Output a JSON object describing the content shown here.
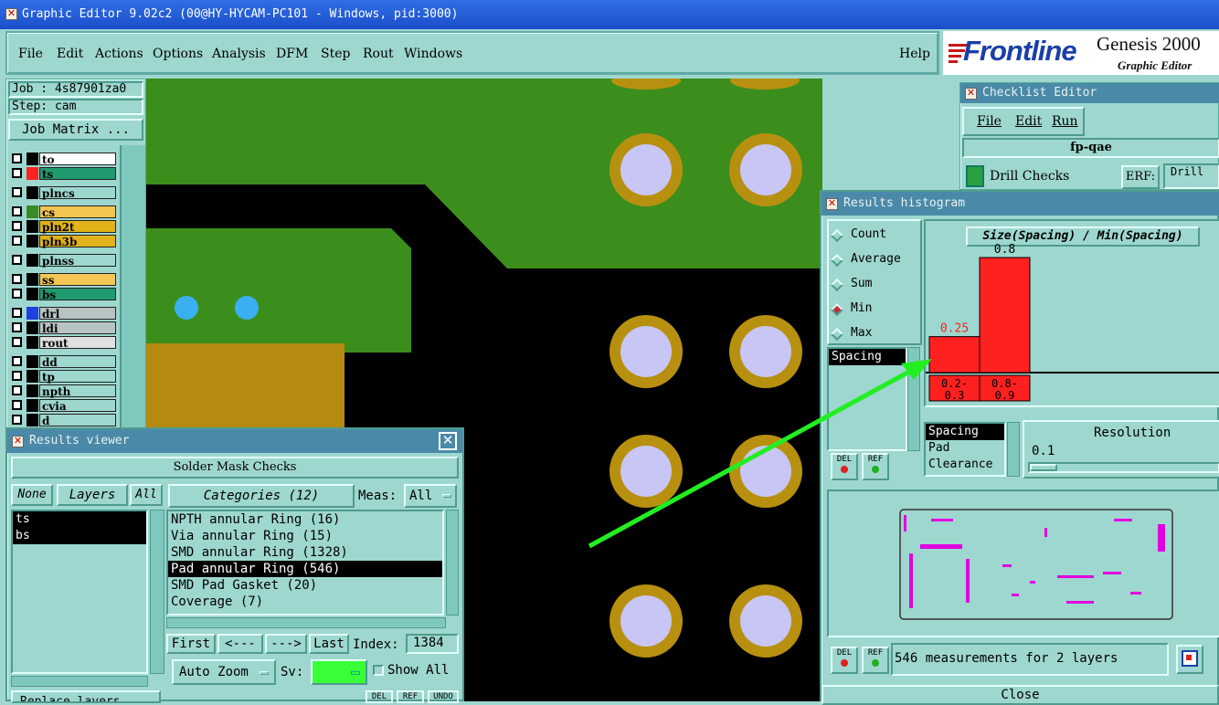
{
  "window": {
    "title": "Graphic Editor 9.02c2 (00@HY-HYCAM-PC101 - Windows, pid:3000)"
  },
  "menu": {
    "items": [
      "File",
      "Edit",
      "Actions",
      "Options",
      "Analysis",
      "DFM",
      "Step",
      "Rout",
      "Windows"
    ],
    "help": "Help"
  },
  "logo": {
    "brand": "Frontline",
    "product": "Genesis 2000",
    "subtitle": "Graphic Editor"
  },
  "job": {
    "job": "Job : 4s87901za0",
    "step": "Step: cam",
    "matrix_button": "Job Matrix ..."
  },
  "layers": [
    {
      "name": "to",
      "color": "#ffffff"
    },
    {
      "name": "ts",
      "color": "#1f9a6e",
      "sw": "#ff2020"
    },
    {
      "name": "plncs",
      "color": "#9ed7cf"
    },
    {
      "name": "cs",
      "color": "#f3c553",
      "sw": "#3b8a28"
    },
    {
      "name": "pln2t",
      "color": "#e3b21a"
    },
    {
      "name": "pln3b",
      "color": "#e3b21a"
    },
    {
      "name": "plnss",
      "color": "#9ed7cf"
    },
    {
      "name": "ss",
      "color": "#f3c553"
    },
    {
      "name": "bs",
      "color": "#1f9a6e"
    },
    {
      "name": "drl",
      "color": "#b8c4c4",
      "sw": "#2040e0"
    },
    {
      "name": "ldi",
      "color": "#b8c4c4"
    },
    {
      "name": "rout",
      "color": "#e0e0e0"
    },
    {
      "name": "dd",
      "color": "#9ed7cf"
    },
    {
      "name": "tp",
      "color": "#9ed7cf"
    },
    {
      "name": "npth",
      "color": "#9ed7cf"
    },
    {
      "name": "cvia",
      "color": "#9ed7cf"
    },
    {
      "name": "d",
      "color": "#9ed7cf"
    }
  ],
  "results_viewer": {
    "title": "Results viewer",
    "section": "Solder Mask Checks",
    "none_label": "None",
    "layers_label": "Layers",
    "all_label": "All",
    "layers": [
      "ts",
      "bs"
    ],
    "categories_label": "Categories (12)",
    "meas_label": "Meas:",
    "meas_value": "All",
    "categories": [
      "NPTH annular Ring (16)",
      "Via annular Ring (15)",
      "SMD annular Ring (1328)",
      "Pad annular Ring (546)",
      "SMD Pad Gasket (20)",
      "Coverage (7)"
    ],
    "selected_category": 3,
    "first": "First",
    "prev": "<---",
    "next": "--->",
    "last": "Last",
    "index_label": "Index:",
    "index_value": "1384",
    "auto_zoom": "Auto Zoom",
    "sv_label": "Sv:",
    "show_all": "Show All",
    "replace_layers": "Replace layers",
    "del": "DEL",
    "ref": "REF",
    "undo": "UNDO"
  },
  "checklist": {
    "title": "Checklist Editor",
    "menu": [
      "File",
      "Edit",
      "Run"
    ],
    "name": "fp-qae",
    "row_label": "Drill Checks",
    "erf_label": "ERF:",
    "erf_value": "Drill"
  },
  "histogram": {
    "title": "Results histogram",
    "modes": [
      "Count",
      "Average",
      "Sum",
      "Min",
      "Max"
    ],
    "selected_mode": 3,
    "list_selected": "Spacing",
    "measures": [
      "Spacing",
      "Pad",
      "Clearance"
    ],
    "resolution_label": "Resolution",
    "resolution_value": "0.1",
    "status": "546 measurements for 2 layers",
    "close": "Close",
    "del": "DEL",
    "ref": "REF"
  },
  "chart_data": {
    "type": "bar",
    "title": "Size(Spacing) / Min(Spacing)",
    "categories": [
      "0.2-0.3",
      "0.8-0.9"
    ],
    "values": [
      0.25,
      0.8
    ],
    "value_labels": [
      "0.25",
      "0.8"
    ],
    "bar_color": "#ff2020",
    "label_colors": [
      "#ff2020",
      "#000000"
    ]
  }
}
